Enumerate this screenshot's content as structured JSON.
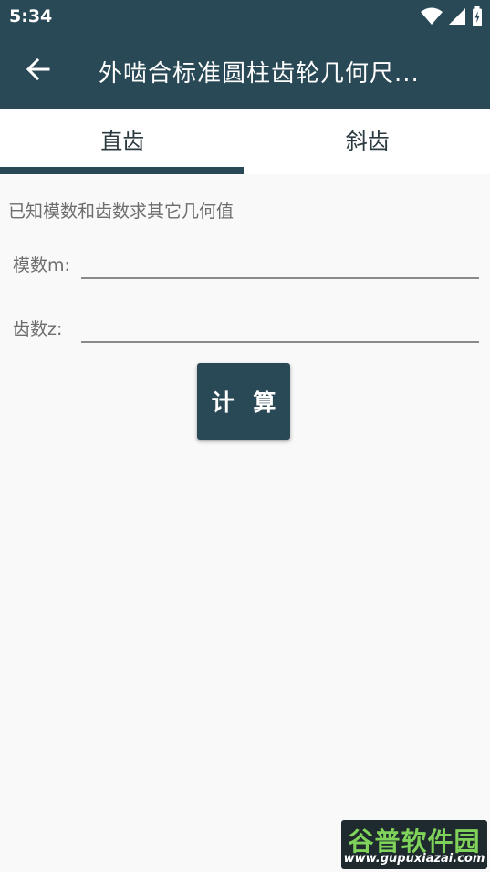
{
  "status_bar": {
    "time": "5:34",
    "icons": [
      "wifi-icon",
      "signal-icon",
      "battery-charging-icon"
    ]
  },
  "toolbar": {
    "title": "外啮合标准圆柱齿轮几何尺...",
    "back_icon": "arrow-left-icon"
  },
  "tabs": [
    {
      "label": "直齿",
      "selected": true
    },
    {
      "label": "斜齿",
      "selected": false
    }
  ],
  "form": {
    "hint": "已知模数和齿数求其它几何值",
    "module_label": "模数m:",
    "module_value": "",
    "teeth_label": "齿数z:",
    "teeth_value": "",
    "calculate_label": "计 算"
  },
  "watermark": {
    "top": "谷普软件园",
    "bottom": "www.gupuxiazai.com"
  },
  "colors": {
    "primary": "#2a4956",
    "background": "#f9f9f9",
    "tab_background": "#ffffff",
    "label_text": "#6d6d6d"
  }
}
